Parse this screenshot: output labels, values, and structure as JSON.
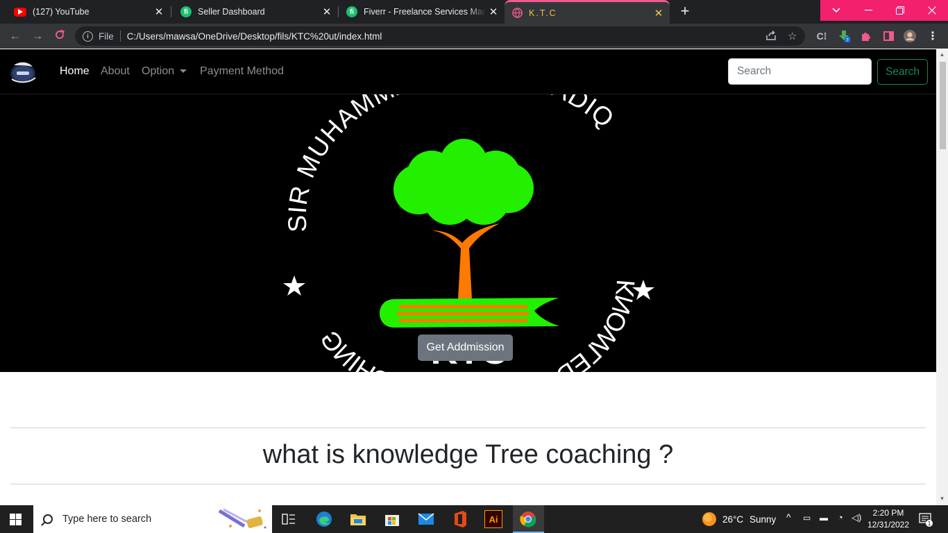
{
  "browser": {
    "tabs": [
      {
        "title": "(127) YouTube",
        "icon": "youtube-icon",
        "active": false
      },
      {
        "title": "Seller Dashboard",
        "icon": "fiverr-icon",
        "active": false
      },
      {
        "title": "Fiverr - Freelance Services Marketplace",
        "icon": "fiverr-icon",
        "active": false
      },
      {
        "title": "K.T.C",
        "icon": "globe-icon",
        "active": true
      }
    ],
    "fiverr_glyph": "fi",
    "close_glyph": "✕",
    "new_tab_glyph": "+",
    "address": {
      "scheme_label": "File",
      "url": "C:/Users/mawsa/OneDrive/Desktop/fils/KTC%20ut/index.html"
    },
    "accent_color": "#f3206e"
  },
  "site": {
    "nav": {
      "items": [
        {
          "label": "Home",
          "active": true
        },
        {
          "label": "About",
          "active": false
        },
        {
          "label": "Option",
          "active": false,
          "dropdown": true
        },
        {
          "label": "Payment Method",
          "active": false
        }
      ],
      "search_placeholder": "Search",
      "search_button": "Search"
    },
    "hero": {
      "logo_top_text": "SIR MUHAMMAD UMAID SADIQ",
      "logo_bottom_text": "KNOWLEDGE TREE COACHING",
      "logo_abbrev": "KTC",
      "cta_label": "Get Addmission",
      "colors": {
        "leaf": "#22f000",
        "trunk": "#ff7a00",
        "background": "#000000"
      }
    },
    "section_heading": "what is knowledge Tree coaching ?"
  },
  "taskbar": {
    "search_placeholder": "Type here to search",
    "weather": {
      "temp": "26°C",
      "condition": "Sunny"
    },
    "time": "2:20 PM",
    "date": "12/31/2022",
    "notification_count": "1",
    "pinned_apps": [
      "task-view-icon",
      "edge-icon",
      "file-explorer-icon",
      "store-icon",
      "mail-icon",
      "office-icon",
      "illustrator-icon",
      "chrome-icon"
    ],
    "illustrator_label": "Ai"
  }
}
